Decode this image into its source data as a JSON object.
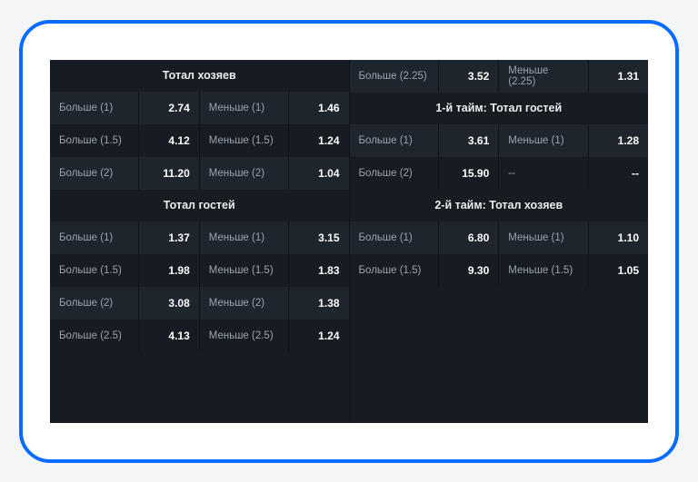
{
  "left": {
    "sections": [
      {
        "title": "Тотал хозяев",
        "rows": [
          {
            "l1": "Больше (1)",
            "o1": "2.74",
            "l2": "Меньше (1)",
            "o2": "1.46"
          },
          {
            "l1": "Больше (1.5)",
            "o1": "4.12",
            "l2": "Меньше (1.5)",
            "o2": "1.24"
          },
          {
            "l1": "Больше (2)",
            "o1": "11.20",
            "l2": "Меньше (2)",
            "o2": "1.04"
          }
        ]
      },
      {
        "title": "Тотал гостей",
        "rows": [
          {
            "l1": "Больше (1)",
            "o1": "1.37",
            "l2": "Меньше (1)",
            "o2": "3.15"
          },
          {
            "l1": "Больше (1.5)",
            "o1": "1.98",
            "l2": "Меньше (1.5)",
            "o2": "1.83"
          },
          {
            "l1": "Больше (2)",
            "o1": "3.08",
            "l2": "Меньше (2)",
            "o2": "1.38"
          },
          {
            "l1": "Больше (2.5)",
            "o1": "4.13",
            "l2": "Меньше (2.5)",
            "o2": "1.24"
          }
        ]
      }
    ]
  },
  "right": {
    "top_row": {
      "l1": "Больше (2.25)",
      "o1": "3.52",
      "l2": "Меньше (2.25)",
      "o2": "1.31"
    },
    "sections": [
      {
        "title": "1-й тайм: Тотал гостей",
        "rows": [
          {
            "l1": "Больше (1)",
            "o1": "3.61",
            "l2": "Меньше (1)",
            "o2": "1.28"
          },
          {
            "l1": "Больше (2)",
            "o1": "15.90",
            "l2": "--",
            "o2": "--"
          }
        ]
      },
      {
        "title": "2-й тайм: Тотал хозяев",
        "rows": [
          {
            "l1": "Больше (1)",
            "o1": "6.80",
            "l2": "Меньше (1)",
            "o2": "1.10"
          },
          {
            "l1": "Больше (1.5)",
            "o1": "9.30",
            "l2": "Меньше (1.5)",
            "o2": "1.05"
          }
        ]
      }
    ]
  }
}
